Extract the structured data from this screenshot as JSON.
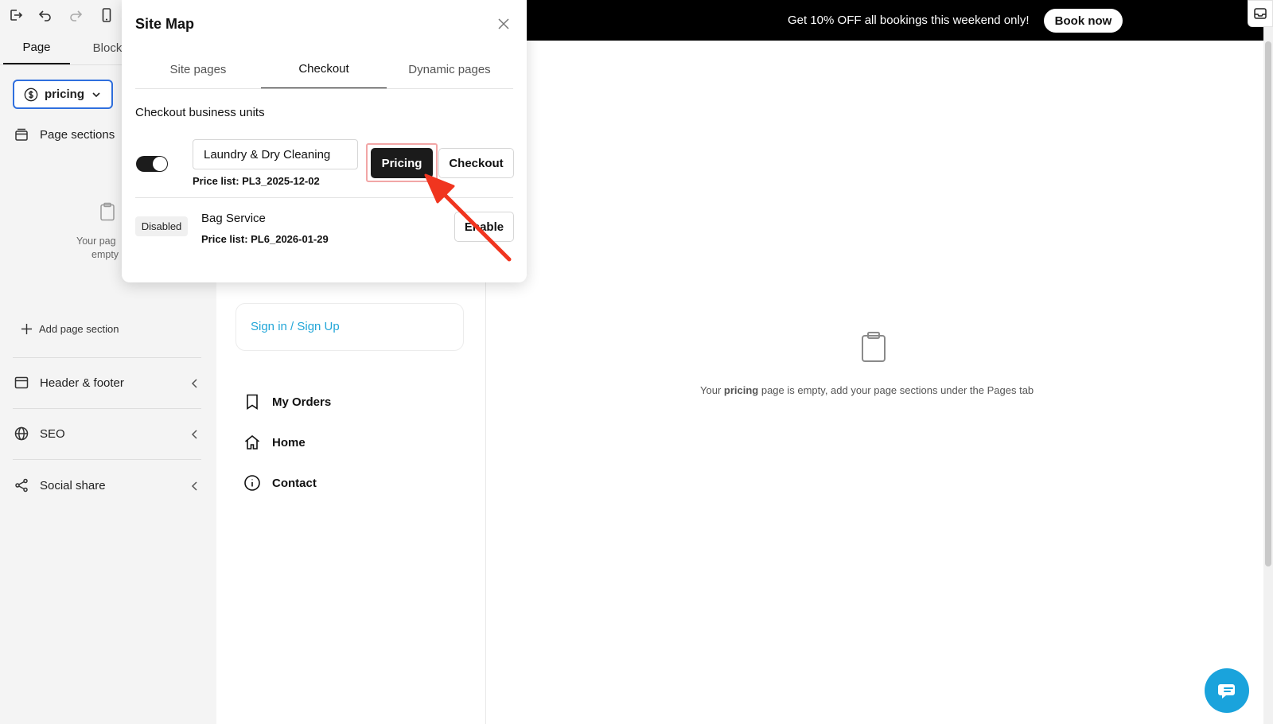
{
  "sidebar": {
    "tabs": [
      {
        "label": "Page"
      },
      {
        "label": "Block"
      }
    ],
    "page_select": {
      "value": "pricing"
    },
    "page_sections_label": "Page sections",
    "empty_text_line1": "Your pag",
    "empty_text_line2": "empty",
    "add_section_label": "Add page section",
    "items": [
      {
        "label": "Header & footer"
      },
      {
        "label": "SEO"
      },
      {
        "label": "Social share"
      }
    ]
  },
  "promo": {
    "text": "Get 10% OFF all bookings this weekend only!",
    "button": "Book now"
  },
  "preview": {
    "signin": "Sign in / Sign Up",
    "nav": [
      {
        "label": "My Orders"
      },
      {
        "label": "Home"
      },
      {
        "label": "Contact"
      }
    ],
    "empty_prefix": "Your ",
    "empty_page": "pricing",
    "empty_suffix": " page is empty, add your page sections under the Pages tab"
  },
  "sitemap": {
    "title": "Site Map",
    "tabs": [
      {
        "label": "Site pages"
      },
      {
        "label": "Checkout"
      },
      {
        "label": "Dynamic pages"
      }
    ],
    "active_tab": "Checkout",
    "section_title": "Checkout business units",
    "units": [
      {
        "name": "Laundry & Dry Cleaning",
        "price_list": "Price list: PL3_2025-12-02",
        "enabled": true,
        "buttons": [
          "Pricing",
          "Checkout"
        ]
      },
      {
        "status": "Disabled",
        "name": "Bag Service",
        "price_list": "Price list: PL6_2026-01-29",
        "button": "Enable"
      }
    ]
  },
  "colors": {
    "accent_blue": "#2f6fde",
    "link_cyan": "#22a6d8",
    "annotation_red": "#f0351f",
    "promo_bg": "#000000"
  }
}
